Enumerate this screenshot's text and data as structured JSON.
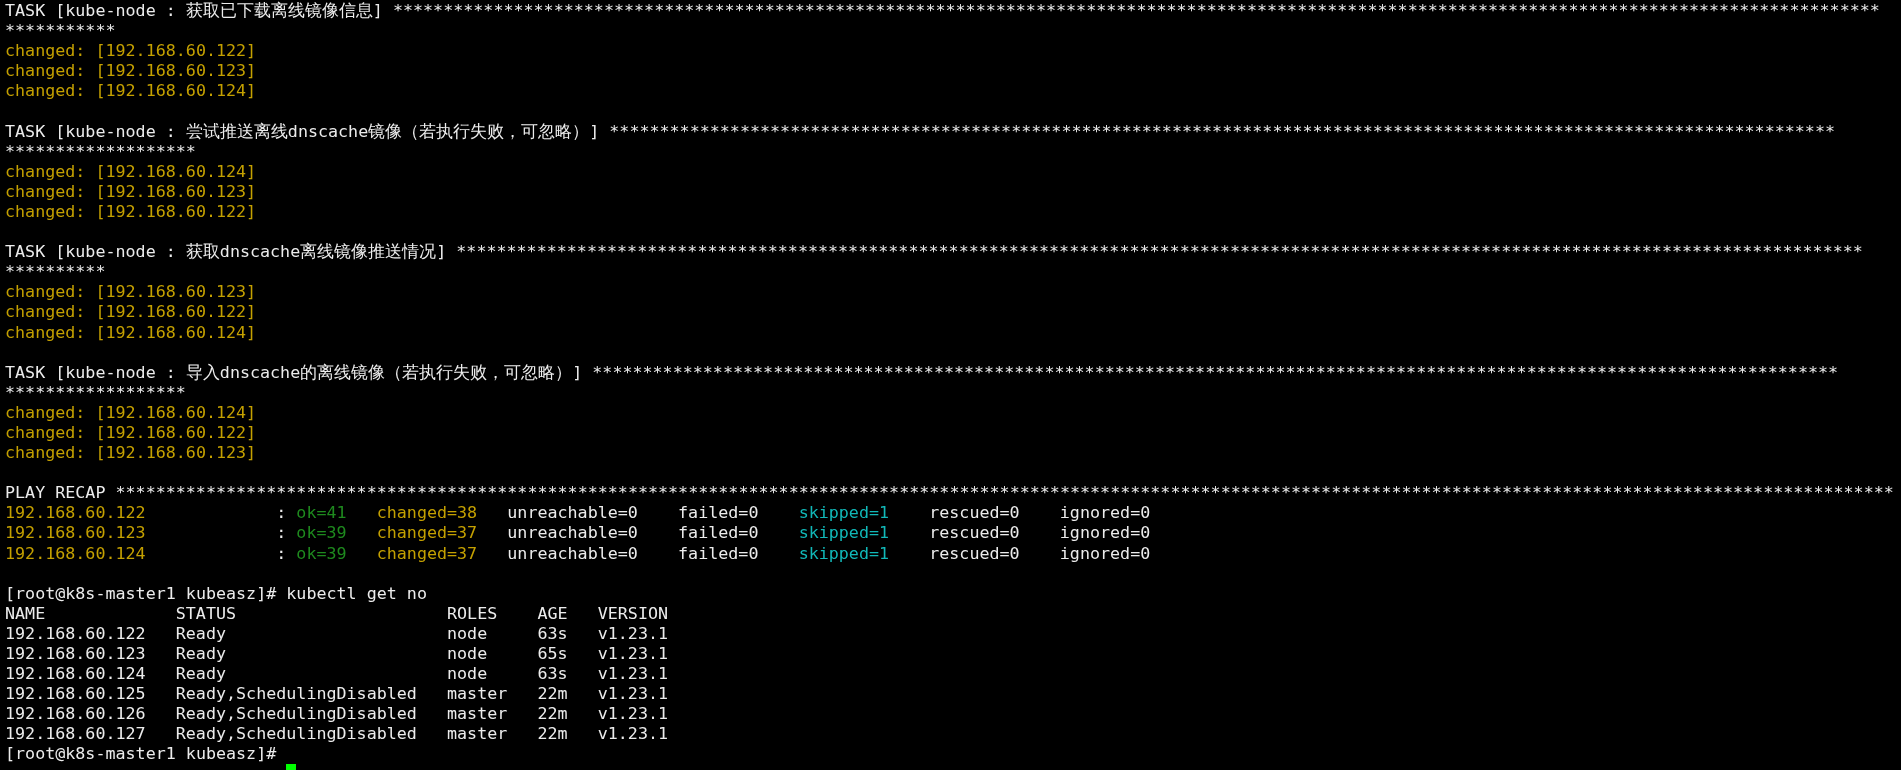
{
  "terminal": {
    "blocks": [
      {
        "kind": "task",
        "title": "TASK [kube-node : 获取已下载离线镜像信息]",
        "stars": "****************************************************************************************************************************************************",
        "stars_continued": "***********",
        "results": [
          {
            "kind": "changed",
            "text": "changed: [192.168.60.122]"
          },
          {
            "kind": "changed",
            "text": "changed: [192.168.60.123]"
          },
          {
            "kind": "changed",
            "text": "changed: [192.168.60.124]"
          }
        ]
      },
      {
        "kind": "task",
        "title": "TASK [kube-node : 尝试推送离线dnscache镜像（若执行失败，可忽略）]",
        "stars": "**************************************************************************************************************************",
        "stars_continued": "*******************",
        "results": [
          {
            "kind": "changed",
            "text": "changed: [192.168.60.124]"
          },
          {
            "kind": "changed",
            "text": "changed: [192.168.60.123]"
          },
          {
            "kind": "changed",
            "text": "changed: [192.168.60.122]"
          }
        ]
      },
      {
        "kind": "task",
        "title": "TASK [kube-node : 获取dnscache离线镜像推送情况]",
        "stars": "********************************************************************************************************************************************",
        "stars_continued": "**********",
        "results": [
          {
            "kind": "changed",
            "text": "changed: [192.168.60.123]"
          },
          {
            "kind": "changed",
            "text": "changed: [192.168.60.122]"
          },
          {
            "kind": "changed",
            "text": "changed: [192.168.60.124]"
          }
        ]
      },
      {
        "kind": "task",
        "title": "TASK [kube-node : 导入dnscache的离线镜像（若执行失败，可忽略）]",
        "stars": "****************************************************************************************************************************",
        "stars_continued": "******************",
        "results": [
          {
            "kind": "changed",
            "text": "changed: [192.168.60.124]"
          },
          {
            "kind": "changed",
            "text": "changed: [192.168.60.122]"
          },
          {
            "kind": "changed",
            "text": "changed: [192.168.60.123]"
          }
        ]
      },
      {
        "kind": "recap",
        "title": "PLAY RECAP",
        "stars": "*********************************************************************************************************************************************************************************",
        "rows": [
          {
            "host": "192.168.60.122",
            "separator": ":",
            "ok": "ok=41",
            "changed": "changed=38",
            "unreachable": "unreachable=0",
            "failed": "failed=0",
            "skipped": "skipped=1",
            "rescued": "rescued=0",
            "ignored": "ignored=0"
          },
          {
            "host": "192.168.60.123",
            "separator": ":",
            "ok": "ok=39",
            "changed": "changed=37",
            "unreachable": "unreachable=0",
            "failed": "failed=0",
            "skipped": "skipped=1",
            "rescued": "rescued=0",
            "ignored": "ignored=0"
          },
          {
            "host": "192.168.60.124",
            "separator": ":",
            "ok": "ok=39",
            "changed": "changed=37",
            "unreachable": "unreachable=0",
            "failed": "failed=0",
            "skipped": "skipped=1",
            "rescued": "rescued=0",
            "ignored": "ignored=0"
          }
        ]
      },
      {
        "kind": "command",
        "prompt": "[root@k8s-master1 kubeasz]#",
        "command": "kubectl get no"
      },
      {
        "kind": "table",
        "columns": [
          "NAME",
          "STATUS",
          "ROLES",
          "AGE",
          "VERSION"
        ],
        "rows": [
          [
            "192.168.60.122",
            "Ready",
            "node",
            "63s",
            "v1.23.1"
          ],
          [
            "192.168.60.123",
            "Ready",
            "node",
            "65s",
            "v1.23.1"
          ],
          [
            "192.168.60.124",
            "Ready",
            "node",
            "63s",
            "v1.23.1"
          ],
          [
            "192.168.60.125",
            "Ready,SchedulingDisabled",
            "master",
            "22m",
            "v1.23.1"
          ],
          [
            "192.168.60.126",
            "Ready,SchedulingDisabled",
            "master",
            "22m",
            "v1.23.1"
          ],
          [
            "192.168.60.127",
            "Ready,SchedulingDisabled",
            "master",
            "22m",
            "v1.23.1"
          ]
        ]
      },
      {
        "kind": "command",
        "prompt": "[root@k8s-master1 kubeasz]#"
      },
      {
        "kind": "command",
        "cursor": true
      }
    ]
  }
}
